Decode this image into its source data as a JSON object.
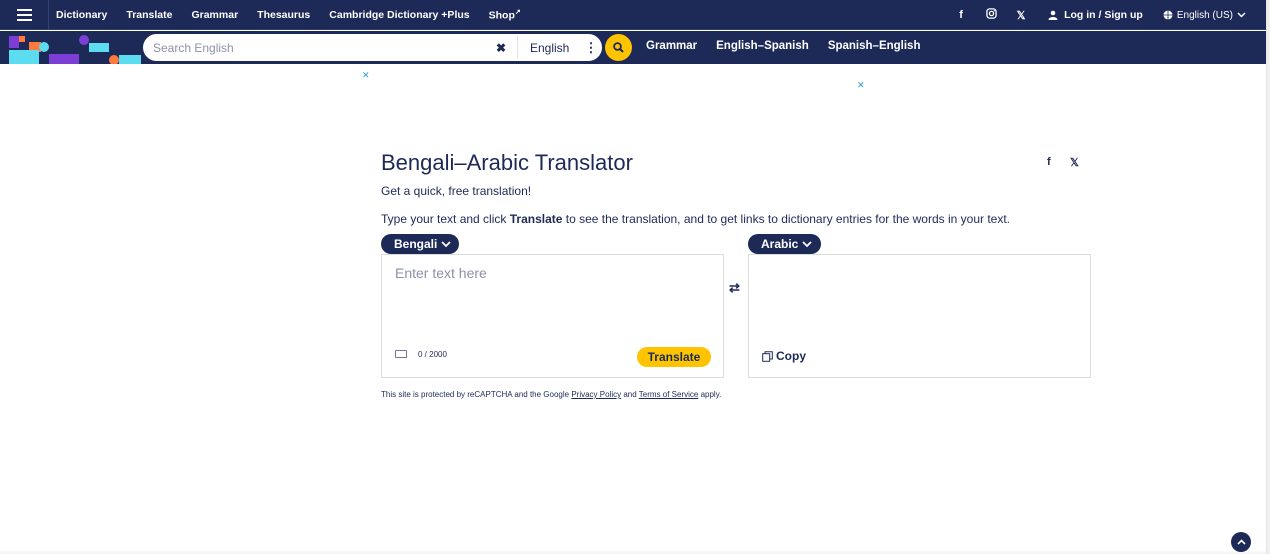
{
  "topnav": {
    "items": [
      "Dictionary",
      "Translate",
      "Grammar",
      "Thesaurus",
      "Cambridge Dictionary +Plus",
      "Shop"
    ],
    "login": "Log in / Sign up",
    "language": "English (US)",
    "icons": [
      "facebook-icon",
      "instagram-icon",
      "x-icon",
      "user-icon",
      "globe-icon"
    ]
  },
  "search": {
    "placeholder": "Search English",
    "dictionary": "English",
    "links": [
      "Grammar",
      "English–Spanish",
      "Spanish–English"
    ]
  },
  "ads": {
    "close": "✕"
  },
  "translator": {
    "title": "Bengali–Arabic Translator",
    "subtitle": "Get a quick, free translation!",
    "instruction_pre": "Type your text and click ",
    "instruction_bold": "Translate",
    "instruction_post": " to see the translation, and to get links to dictionary entries for the words in your text.",
    "source_lang": "Bengali",
    "target_lang": "Arabic",
    "input_placeholder": "Enter text here",
    "char_count": "0 / 2000",
    "translate_button": "Translate",
    "copy_button": "Copy"
  },
  "recaptcha": {
    "text_pre": "This site is protected by reCAPTCHA and the Google ",
    "privacy": "Privacy Policy",
    "and": " and ",
    "terms": "Terms of Service",
    "text_post": " apply."
  },
  "colors": {
    "navy": "#1d2a57",
    "accent": "#fec400"
  }
}
